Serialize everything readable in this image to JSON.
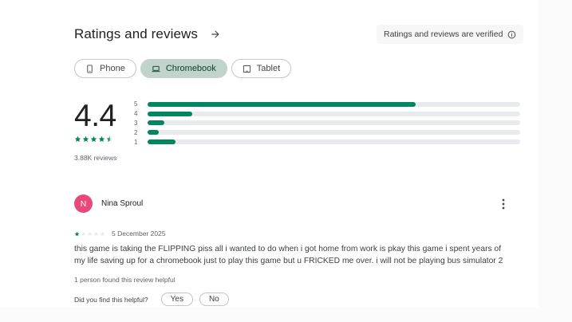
{
  "header": {
    "title": "Ratings and reviews",
    "verified_label": "Ratings and reviews are verified"
  },
  "device_chips": [
    {
      "label": "Phone",
      "icon": "phone-icon",
      "selected": false
    },
    {
      "label": "Chromebook",
      "icon": "chromebook-icon",
      "selected": true
    },
    {
      "label": "Tablet",
      "icon": "tablet-icon",
      "selected": false
    }
  ],
  "summary": {
    "score": "4.4",
    "stars_filled": 4.5,
    "review_count": "3.88K reviews"
  },
  "distribution": [
    {
      "label": "5",
      "fraction": 0.72
    },
    {
      "label": "4",
      "fraction": 0.12
    },
    {
      "label": "3",
      "fraction": 0.045
    },
    {
      "label": "2",
      "fraction": 0.03
    },
    {
      "label": "1",
      "fraction": 0.075
    }
  ],
  "review": {
    "avatar_letter": "N",
    "reviewer_name": "Nina Sproul",
    "rating": 1,
    "date": "5 December 2025",
    "text": "this game is taking the FLIPPING piss all i wanted to do when i got home from work is pkay this game i spent years of my life saving up for a chromebook just to play this game but u FRICKED me over. i will not be playing bus simulator 2",
    "helpful_count": "1 person found this review helpful",
    "helpful_question": "Did you find this helpful?",
    "yes_label": "Yes",
    "no_label": "No"
  },
  "colors": {
    "accent": "#01875f",
    "selected_chip": "#c2d3cb",
    "avatar": "#e8497a",
    "track": "#e8eaed"
  }
}
